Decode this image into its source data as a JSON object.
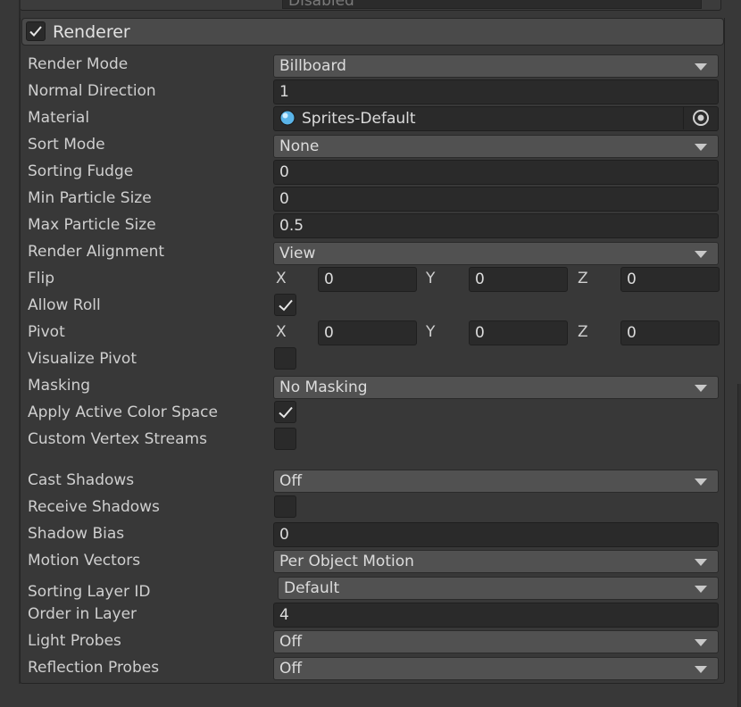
{
  "top_strip": {
    "value": "Disabled"
  },
  "module": {
    "title": "Renderer",
    "enabled": true
  },
  "rows": {
    "render_mode": {
      "label": "Render Mode",
      "value": "Billboard"
    },
    "normal_direction": {
      "label": "Normal Direction",
      "value": "1"
    },
    "material": {
      "label": "Material",
      "value": "Sprites-Default"
    },
    "sort_mode": {
      "label": "Sort Mode",
      "value": "None"
    },
    "sorting_fudge": {
      "label": "Sorting Fudge",
      "value": "0"
    },
    "min_particle_size": {
      "label": "Min Particle Size",
      "value": "0"
    },
    "max_particle_size": {
      "label": "Max Particle Size",
      "value": "0.5"
    },
    "render_alignment": {
      "label": "Render Alignment",
      "value": "View"
    },
    "flip": {
      "label": "Flip",
      "x_label": "X",
      "x": "0",
      "y_label": "Y",
      "y": "0",
      "z_label": "Z",
      "z": "0"
    },
    "allow_roll": {
      "label": "Allow Roll",
      "checked": true
    },
    "pivot": {
      "label": "Pivot",
      "x_label": "X",
      "x": "0",
      "y_label": "Y",
      "y": "0",
      "z_label": "Z",
      "z": "0"
    },
    "visualize_pivot": {
      "label": "Visualize Pivot",
      "checked": false
    },
    "masking": {
      "label": "Masking",
      "value": "No Masking"
    },
    "apply_active_color_space": {
      "label": "Apply Active Color Space",
      "checked": true
    },
    "custom_vertex_streams": {
      "label": "Custom Vertex Streams",
      "checked": false
    },
    "cast_shadows": {
      "label": "Cast Shadows",
      "value": "Off"
    },
    "receive_shadows": {
      "label": "Receive Shadows",
      "checked": false
    },
    "shadow_bias": {
      "label": "Shadow Bias",
      "value": "0"
    },
    "motion_vectors": {
      "label": "Motion Vectors",
      "value": "Per Object Motion"
    },
    "sorting_layer_id": {
      "label": "Sorting Layer ID",
      "value": "Default"
    },
    "order_in_layer": {
      "label": "Order in Layer",
      "value": "4"
    },
    "light_probes": {
      "label": "Light Probes",
      "value": "Off"
    },
    "reflection_probes": {
      "label": "Reflection Probes",
      "value": "Off"
    }
  },
  "icons": {
    "check": "checkmark-icon",
    "dropdown": "chevron-down-icon",
    "material": "material-sphere-icon",
    "picker": "object-picker-icon"
  },
  "colors": {
    "panel_bg": "#383838",
    "header_bg": "#4a4a4a",
    "input_bg": "#2a2a2a",
    "dropdown_bg": "#515151",
    "material_icon": "#5ab4e8"
  }
}
